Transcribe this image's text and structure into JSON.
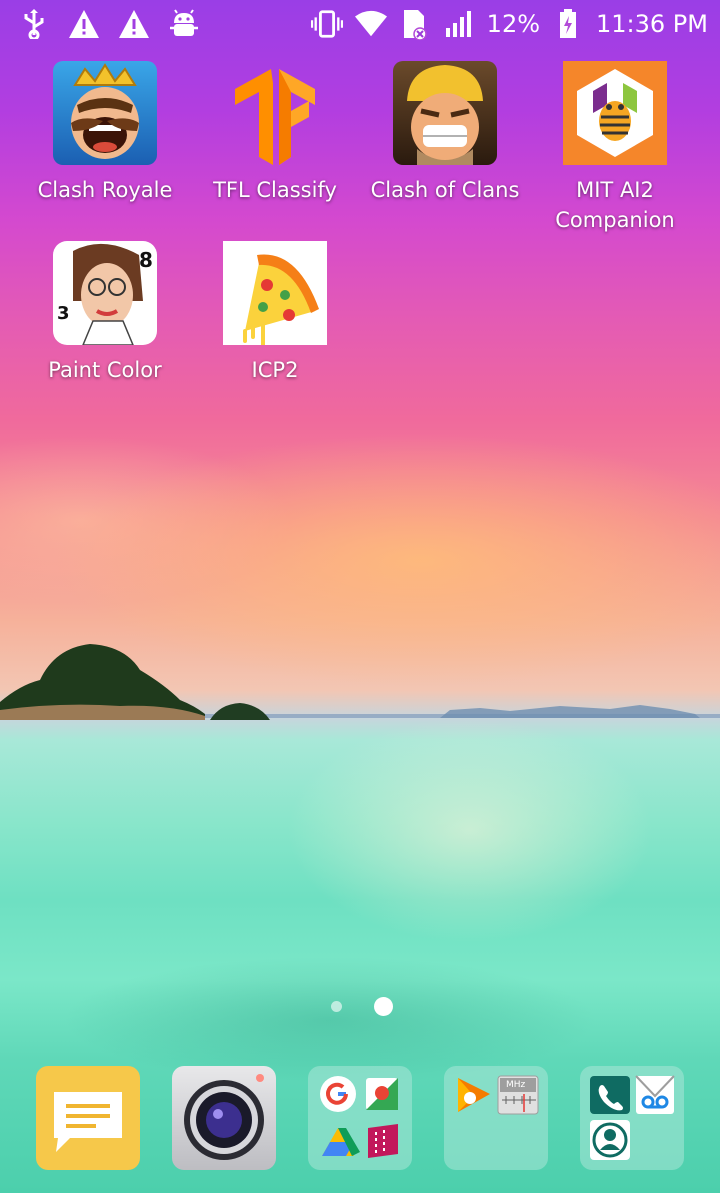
{
  "status_bar": {
    "battery": "12%",
    "time": "11:36 PM",
    "left_icons": [
      "usb-icon",
      "warning-icon",
      "warning-icon",
      "android-debug-icon"
    ],
    "right_icons": [
      "vibrate-icon",
      "wifi-icon",
      "no-sim-icon",
      "signal-icon",
      "charging-battery-icon"
    ]
  },
  "apps": [
    {
      "label": "Clash Royale"
    },
    {
      "label": "TFL Classify"
    },
    {
      "label": "Clash of Clans"
    },
    {
      "label": "MIT AI2 Companion"
    },
    {
      "label": "Paint Color"
    },
    {
      "label": "ICP2"
    }
  ],
  "pager": {
    "pages": 2,
    "current": 2
  },
  "dock": [
    {
      "name": "Messages"
    },
    {
      "name": "Camera"
    },
    {
      "name": "Google folder"
    },
    {
      "name": "Media folder",
      "radio_label": "MHz"
    },
    {
      "name": "Phone folder"
    }
  ],
  "colors": {
    "tf_orange": "#FF8F00",
    "mit_orange": "#F5862A",
    "mit_purple": "#7B2D8E",
    "mit_green": "#8DC63F"
  }
}
